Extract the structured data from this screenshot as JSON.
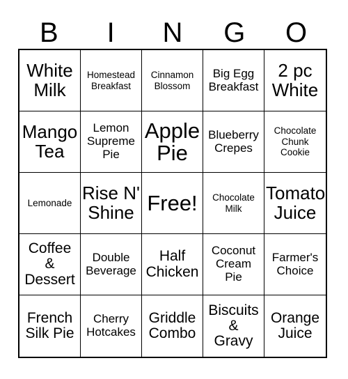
{
  "card": {
    "title": "BINGO",
    "header_letters": [
      "B",
      "I",
      "N",
      "G",
      "O"
    ],
    "free_space_label": "Free!",
    "colors": {
      "background": "#ffffff",
      "text": "#000000",
      "grid_line": "#000000"
    },
    "grid_size": "5x5",
    "columns": 5,
    "rows": 5,
    "cells": [
      {
        "row": 1,
        "col": 1,
        "column_letter": "B",
        "text": "White\nMilk",
        "size": "lg"
      },
      {
        "row": 1,
        "col": 2,
        "column_letter": "I",
        "text": "Homestead\nBreakfast",
        "size": "xs"
      },
      {
        "row": 1,
        "col": 3,
        "column_letter": "N",
        "text": "Cinnamon\nBlossom",
        "size": "xs"
      },
      {
        "row": 1,
        "col": 4,
        "column_letter": "G",
        "text": "Big Egg\nBreakfast",
        "size": "sm"
      },
      {
        "row": 1,
        "col": 5,
        "column_letter": "O",
        "text": "2 pc\nWhite",
        "size": "lg"
      },
      {
        "row": 2,
        "col": 1,
        "column_letter": "B",
        "text": "Mango\nTea",
        "size": "lg"
      },
      {
        "row": 2,
        "col": 2,
        "column_letter": "I",
        "text": "Lemon\nSupreme\nPie",
        "size": "sm"
      },
      {
        "row": 2,
        "col": 3,
        "column_letter": "N",
        "text": "Apple\nPie",
        "size": "xl"
      },
      {
        "row": 2,
        "col": 4,
        "column_letter": "G",
        "text": "Blueberry\nCrepes",
        "size": "sm"
      },
      {
        "row": 2,
        "col": 5,
        "column_letter": "O",
        "text": "Chocolate\nChunk\nCookie",
        "size": "xs"
      },
      {
        "row": 3,
        "col": 1,
        "column_letter": "B",
        "text": "Lemonade",
        "size": "xs"
      },
      {
        "row": 3,
        "col": 2,
        "column_letter": "I",
        "text": "Rise N'\nShine",
        "size": "lg"
      },
      {
        "row": 3,
        "col": 3,
        "column_letter": "N",
        "text": "Free!",
        "size": "xl"
      },
      {
        "row": 3,
        "col": 4,
        "column_letter": "G",
        "text": "Chocolate\nMilk",
        "size": "xs"
      },
      {
        "row": 3,
        "col": 5,
        "column_letter": "O",
        "text": "Tomato\nJuice",
        "size": "lg"
      },
      {
        "row": 4,
        "col": 1,
        "column_letter": "B",
        "text": "Coffee\n&\nDessert",
        "size": "md"
      },
      {
        "row": 4,
        "col": 2,
        "column_letter": "I",
        "text": "Double\nBeverage",
        "size": "sm"
      },
      {
        "row": 4,
        "col": 3,
        "column_letter": "N",
        "text": "Half\nChicken",
        "size": "md"
      },
      {
        "row": 4,
        "col": 4,
        "column_letter": "G",
        "text": "Coconut\nCream\nPie",
        "size": "sm"
      },
      {
        "row": 4,
        "col": 5,
        "column_letter": "O",
        "text": "Farmer's\nChoice",
        "size": "sm"
      },
      {
        "row": 5,
        "col": 1,
        "column_letter": "B",
        "text": "French\nSilk Pie",
        "size": "md"
      },
      {
        "row": 5,
        "col": 2,
        "column_letter": "I",
        "text": "Cherry\nHotcakes",
        "size": "sm"
      },
      {
        "row": 5,
        "col": 3,
        "column_letter": "N",
        "text": "Griddle\nCombo",
        "size": "md"
      },
      {
        "row": 5,
        "col": 4,
        "column_letter": "G",
        "text": "Biscuits\n&\nGravy",
        "size": "md"
      },
      {
        "row": 5,
        "col": 5,
        "column_letter": "O",
        "text": "Orange\nJuice",
        "size": "md"
      }
    ]
  }
}
